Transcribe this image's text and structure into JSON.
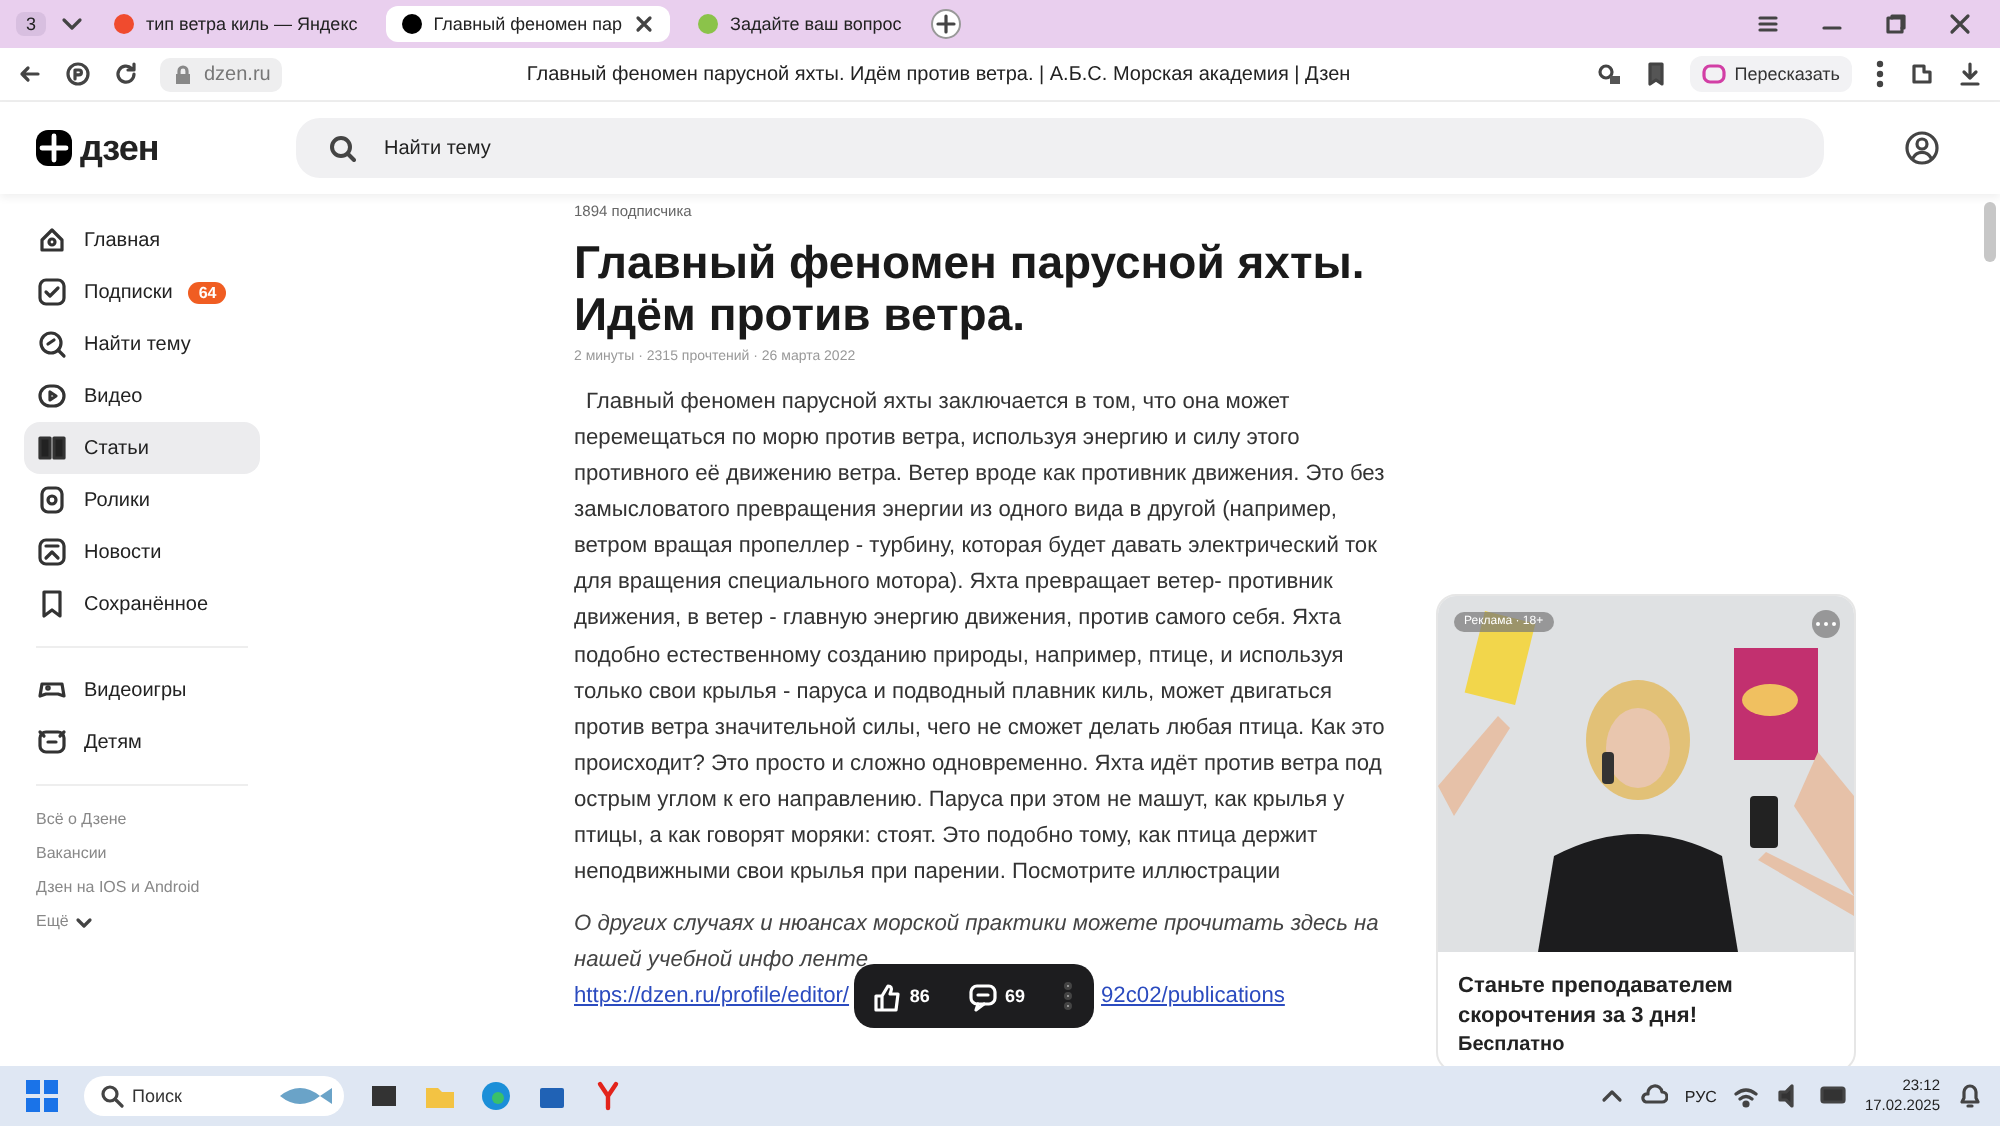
{
  "browser": {
    "tab_count": "3",
    "tabs": [
      {
        "title": "тип ветра киль — Яндекс",
        "selected": false,
        "color": "#f04b2e"
      },
      {
        "title": "Главный феномен пар",
        "selected": true,
        "color": "#000000"
      },
      {
        "title": "Задайте ваш вопрос",
        "selected": false,
        "color": "#8bc34a"
      }
    ],
    "address": "dzen.ru",
    "page_title": "Главный феномен парусной яхты. Идём против ветра. | А.Б.С. Морская академия | Дзен",
    "retell_button": "Пересказать"
  },
  "header": {
    "logo": "дзен",
    "search": {
      "placeholder": "Найти тему"
    }
  },
  "sidebar": {
    "items": [
      {
        "label": "Главная",
        "selected": false
      },
      {
        "label": "Подписки",
        "selected": false,
        "badge": "64"
      },
      {
        "label": "Найти тему",
        "selected": false
      },
      {
        "label": "Видео",
        "selected": false
      },
      {
        "label": "Статьи",
        "selected": true
      },
      {
        "label": "Ролики",
        "selected": false
      },
      {
        "label": "Новости",
        "selected": false
      },
      {
        "label": "Сохранённое",
        "selected": false
      }
    ],
    "extra_items": [
      {
        "label": "Видеоигры",
        "selected": false
      },
      {
        "label": "Детям",
        "selected": false
      }
    ],
    "links": [
      "Всё о Дзене",
      "Вакансии",
      "Дзен на IOS и Android"
    ],
    "more": "Ещё"
  },
  "article": {
    "subscribers": "1894 подписчика",
    "title": "Главный феномен парусной яхты. Идём против ветра.",
    "meta": "2 минуты · 2315 прочтений · 26 марта 2022",
    "body": "Главный феномен парусной яхты заключается в том, что она может перемещаться по морю против ветра, используя энергию и силу этого противного её движению ветра. Ветер вроде как противник движения. Это без замысловатого превращения энергии из одного вида в другой (например, ветром вращая пропеллер - турбину, которая будет давать электрический ток для вращения специального мотора). Яхта превращает ветер- противник движения, в ветер - главную энергию движения, против самого себя. Яхта подобно естественному созданию природы, например, птице, и используя только свои крылья - паруса и подводный плавник киль, может двигаться против ветра значительной силы, чего не сможет делать любая птица. Как это происходит? Это просто и сложно одновременно. Яхта идёт против ветра под острым углом к его направлению. Паруса при этом не машут, как крылья у птицы, а как говорят моряки: стоят. Это подобно тому, как птица держит неподвижными свои крылья при парении. Посмотрите иллюстрации",
    "note": "О других случаях и нюансах морской практики можете прочитать здесь на нашей учебной инфо ленте",
    "link_parts": [
      "https://dzen.ru/profile/editor/",
      "92c02/publications"
    ]
  },
  "reactions": {
    "likes": "86",
    "comments": "69"
  },
  "ad": {
    "tag": "Реклама · 18+",
    "title": "Станьте преподавателем скорочтения за 3 дня!",
    "subtitle": "Бесплатно"
  },
  "taskbar": {
    "search": {
      "placeholder": "Поиск"
    },
    "language": "РУС",
    "time": "23:12",
    "date": "17.02.2025"
  }
}
